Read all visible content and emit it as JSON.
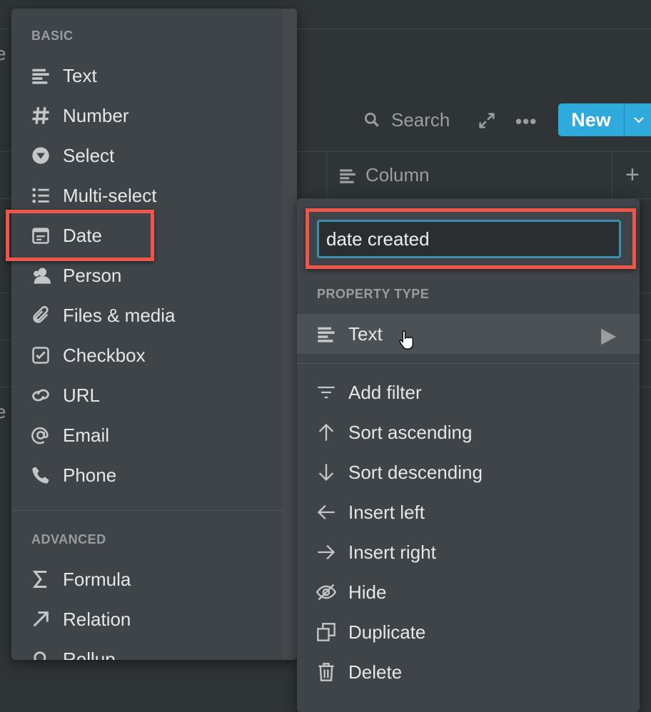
{
  "background": {
    "partial_text": [
      "e",
      "e"
    ],
    "toolbar": {
      "search_label": "Search",
      "new_label": "New"
    },
    "column_header": "Column"
  },
  "type_menu": {
    "basic_label": "BASIC",
    "basic_items": [
      {
        "label": "Text",
        "icon": "text-icon"
      },
      {
        "label": "Number",
        "icon": "number-icon"
      },
      {
        "label": "Select",
        "icon": "select-icon"
      },
      {
        "label": "Multi-select",
        "icon": "multi-select-icon"
      },
      {
        "label": "Date",
        "icon": "calendar-icon"
      },
      {
        "label": "Person",
        "icon": "person-icon"
      },
      {
        "label": "Files & media",
        "icon": "paperclip-icon"
      },
      {
        "label": "Checkbox",
        "icon": "checkbox-icon"
      },
      {
        "label": "URL",
        "icon": "link-icon"
      },
      {
        "label": "Email",
        "icon": "at-icon"
      },
      {
        "label": "Phone",
        "icon": "phone-icon"
      }
    ],
    "advanced_label": "ADVANCED",
    "advanced_items": [
      {
        "label": "Formula",
        "icon": "sigma-icon"
      },
      {
        "label": "Relation",
        "icon": "arrow-up-right-icon"
      },
      {
        "label": "Rollup",
        "icon": "search-icon"
      }
    ]
  },
  "property_menu": {
    "name_value": "date created",
    "property_type_label": "PROPERTY TYPE",
    "current_type": "Text",
    "actions": [
      {
        "label": "Add filter",
        "icon": "filter-icon"
      },
      {
        "label": "Sort ascending",
        "icon": "arrow-up-icon"
      },
      {
        "label": "Sort descending",
        "icon": "arrow-down-icon"
      },
      {
        "label": "Insert left",
        "icon": "arrow-left-icon"
      },
      {
        "label": "Insert right",
        "icon": "arrow-right-icon"
      },
      {
        "label": "Hide",
        "icon": "eye-off-icon"
      },
      {
        "label": "Duplicate",
        "icon": "duplicate-icon"
      },
      {
        "label": "Delete",
        "icon": "trash-icon"
      }
    ]
  },
  "colors": {
    "accent": "#2eaadc",
    "highlight": "#f0554a",
    "background": "#2f3437",
    "menu": "#3f4448"
  }
}
